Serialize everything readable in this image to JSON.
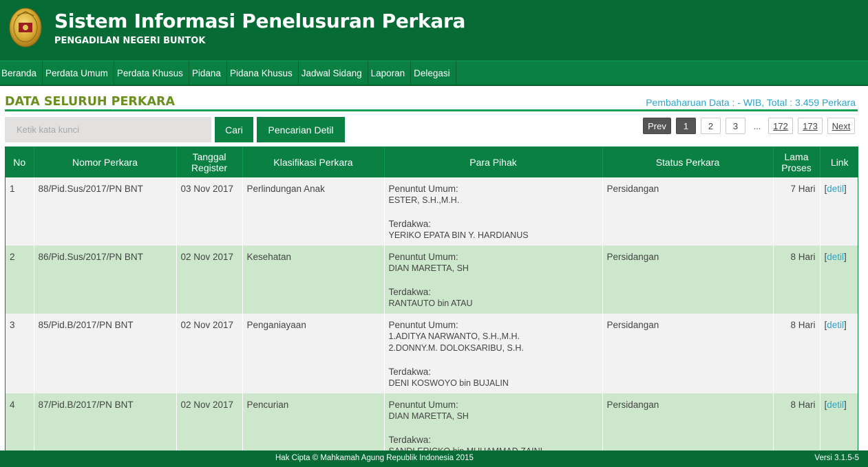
{
  "header": {
    "title": "Sistem Informasi Penelusuran Perkara",
    "subtitle": "PENGADILAN NEGERI BUNTOK"
  },
  "nav": {
    "items": [
      "Beranda",
      "Perdata Umum",
      "Perdata Khusus",
      "Pidana",
      "Pidana Khusus",
      "Jadwal Sidang",
      "Laporan",
      "Delegasi"
    ]
  },
  "section": {
    "title": "DATA SELURUH PERKARA",
    "update_info": "Pembaharuan Data : - WIB, Total : 3.459 Perkara"
  },
  "search": {
    "placeholder": "Ketik kata kunci",
    "button_label": "Cari",
    "advanced_label": "Pencarian Detil"
  },
  "pagination": {
    "prev": "Prev",
    "current": "1",
    "pages": [
      "2",
      "3"
    ],
    "ellipsis": "...",
    "last_pages": [
      "172",
      "173"
    ],
    "next": "Next"
  },
  "table": {
    "headers": {
      "no": "No",
      "nomor": "Nomor Perkara",
      "tanggal": "Tanggal Register",
      "klasifikasi": "Klasifikasi Perkara",
      "pihak": "Para Pihak",
      "status": "Status Perkara",
      "lama": "Lama Proses",
      "link": "Link"
    },
    "prosecutor_label": "Penuntut Umum:",
    "defendant_label": "Terdakwa:",
    "rows": [
      {
        "no": "1",
        "nomor": "88/Pid.Sus/2017/PN BNT",
        "tanggal": "03 Nov 2017",
        "klasifikasi": "Perlindungan Anak",
        "penuntut": [
          "ESTER, S.H.,M.H."
        ],
        "terdakwa": [
          "YERIKO EPATA BIN Y. HARDIANUS"
        ],
        "status": "Persidangan",
        "lama": "7 Hari",
        "link": "detil"
      },
      {
        "no": "2",
        "nomor": "86/Pid.Sus/2017/PN BNT",
        "tanggal": "02 Nov 2017",
        "klasifikasi": "Kesehatan",
        "penuntut": [
          "DIAN MARETTA, SH"
        ],
        "terdakwa": [
          "RANTAUTO bin ATAU"
        ],
        "status": "Persidangan",
        "lama": "8 Hari",
        "link": "detil"
      },
      {
        "no": "3",
        "nomor": "85/Pid.B/2017/PN BNT",
        "tanggal": "02 Nov 2017",
        "klasifikasi": "Penganiayaan",
        "penuntut": [
          "1.ADITYA NARWANTO, S.H.,M.H.",
          "2.DONNY.M. DOLOKSARIBU, S.H."
        ],
        "terdakwa": [
          "DENI KOSWOYO bin BUJALIN"
        ],
        "status": "Persidangan",
        "lama": "8 Hari",
        "link": "detil"
      },
      {
        "no": "4",
        "nomor": "87/Pid.B/2017/PN BNT",
        "tanggal": "02 Nov 2017",
        "klasifikasi": "Pencurian",
        "penuntut": [
          "DIAN MARETTA, SH"
        ],
        "terdakwa": [
          "SANDI ERICKO bin MUHAMMAD ZAINI"
        ],
        "status": "Persidangan",
        "lama": "8 Hari",
        "link": "detil"
      }
    ]
  },
  "footer": {
    "copyright": "Hak Cipta © Mahkamah Agung Republik Indonesia 2015",
    "version": "Versi 3.1.5-5"
  }
}
